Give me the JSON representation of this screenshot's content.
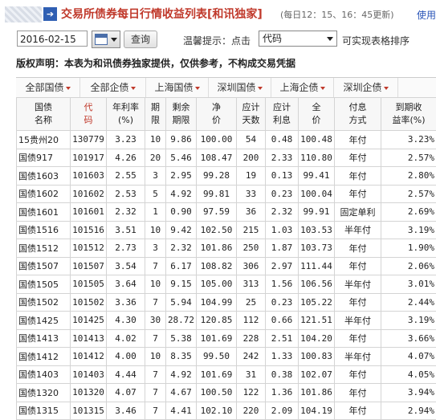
{
  "header": {
    "title": "交易所债券每日行情收益列表[和讯独家]",
    "update_note": "(每日12：15、16：45更新)",
    "help_link": "使用"
  },
  "toolbar": {
    "date_value": "2016-02-15",
    "query_label": "查询",
    "tip_label": "温馨提示：点击",
    "sort_selected": "代码",
    "sort_tip": "可实现表格排序"
  },
  "copyright": "版权声明：本表为和讯债券独家提供，仅供参考，不构成交易凭据",
  "tabs": [
    "全部国债",
    "全部企债",
    "上海国债",
    "深圳国债",
    "上海企债",
    "深圳企债"
  ],
  "table": {
    "headers": [
      [
        "国债",
        "名称"
      ],
      [
        "代",
        "码"
      ],
      [
        "年利率",
        "(%)"
      ],
      [
        "期",
        "限"
      ],
      [
        "剩余",
        "期限"
      ],
      [
        "净",
        "价"
      ],
      [
        "应计",
        "天数"
      ],
      [
        "应计",
        "利息"
      ],
      [
        "全",
        "价"
      ],
      [
        "付息",
        "方式"
      ],
      [
        "到期收",
        "益率(%)"
      ]
    ],
    "rows": [
      [
        "15贵州20",
        "130779",
        "3.23",
        "10",
        "9.86",
        "100.00",
        "54",
        "0.48",
        "100.48",
        "年付",
        "3.23%"
      ],
      [
        "国债917",
        "101917",
        "4.26",
        "20",
        "5.46",
        "108.47",
        "200",
        "2.33",
        "110.80",
        "年付",
        "2.57%"
      ],
      [
        "国债1603",
        "101603",
        "2.55",
        "3",
        "2.95",
        "99.28",
        "19",
        "0.13",
        "99.41",
        "年付",
        "2.80%"
      ],
      [
        "国债1602",
        "101602",
        "2.53",
        "5",
        "4.92",
        "99.81",
        "33",
        "0.23",
        "100.04",
        "年付",
        "2.57%"
      ],
      [
        "国债1601",
        "101601",
        "2.32",
        "1",
        "0.90",
        "97.59",
        "36",
        "2.32",
        "99.91",
        "固定单利",
        "2.69%"
      ],
      [
        "国债1516",
        "101516",
        "3.51",
        "10",
        "9.42",
        "102.50",
        "215",
        "1.03",
        "103.53",
        "半年付",
        "3.19%"
      ],
      [
        "国债1512",
        "101512",
        "2.73",
        "3",
        "2.32",
        "101.86",
        "250",
        "1.87",
        "103.73",
        "年付",
        "1.90%"
      ],
      [
        "国债1507",
        "101507",
        "3.54",
        "7",
        "6.17",
        "108.82",
        "306",
        "2.97",
        "111.44",
        "年付",
        "2.06%"
      ],
      [
        "国债1505",
        "101505",
        "3.64",
        "10",
        "9.15",
        "105.00",
        "313",
        "1.56",
        "106.56",
        "半年付",
        "3.01%"
      ],
      [
        "国债1502",
        "101502",
        "3.36",
        "7",
        "5.94",
        "104.99",
        "25",
        "0.23",
        "105.22",
        "年付",
        "2.44%"
      ],
      [
        "国债1425",
        "101425",
        "4.30",
        "30",
        "28.72",
        "120.85",
        "112",
        "0.66",
        "121.51",
        "半年付",
        "3.19%"
      ],
      [
        "国债1413",
        "101413",
        "4.02",
        "7",
        "5.38",
        "101.69",
        "228",
        "2.51",
        "104.20",
        "年付",
        "3.66%"
      ],
      [
        "国债1412",
        "101412",
        "4.00",
        "10",
        "8.35",
        "99.50",
        "242",
        "1.33",
        "100.83",
        "半年付",
        "4.07%"
      ],
      [
        "国债1403",
        "101403",
        "4.44",
        "7",
        "4.92",
        "101.69",
        "31",
        "0.38",
        "102.07",
        "年付",
        "4.05%"
      ],
      [
        "国债1320",
        "101320",
        "4.07",
        "7",
        "4.67",
        "100.50",
        "122",
        "1.36",
        "101.86",
        "年付",
        "3.94%"
      ],
      [
        "国债1315",
        "101315",
        "3.46",
        "7",
        "4.41",
        "102.10",
        "220",
        "2.09",
        "104.19",
        "年付",
        "2.94%"
      ]
    ]
  }
}
